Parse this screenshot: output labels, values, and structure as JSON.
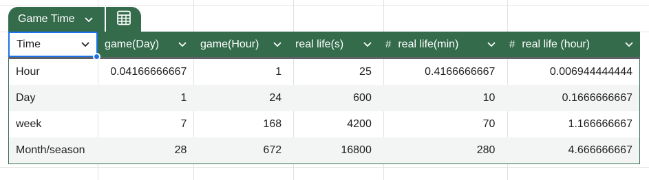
{
  "table_tab": {
    "name": "Game Time",
    "view_icon": "table-view-icon"
  },
  "columns": [
    {
      "label": "Time",
      "type_icon": "",
      "align": "left"
    },
    {
      "label": "game(Day)",
      "type_icon": "",
      "align": "right"
    },
    {
      "label": "game(Hour)",
      "type_icon": "",
      "align": "right"
    },
    {
      "label": "real life(s)",
      "type_icon": "",
      "align": "right"
    },
    {
      "label": "real life(min)",
      "type_icon": "#",
      "align": "right"
    },
    {
      "label": "real life (hour)",
      "type_icon": "#",
      "align": "right"
    }
  ],
  "rows": [
    [
      "Hour",
      "0.04166666667",
      "1",
      "25",
      "0.4166666667",
      "0.006944444444"
    ],
    [
      "Day",
      "1",
      "24",
      "600",
      "10",
      "0.1666666667"
    ],
    [
      "week",
      "7",
      "168",
      "4200",
      "70",
      "1.166666667"
    ],
    [
      "Month/season",
      "28",
      "672",
      "16800",
      "280",
      "4.666666667"
    ]
  ],
  "colors": {
    "header_bg": "#336b4b",
    "selection": "#1a73e8",
    "alt_row": "#f3f5f4"
  }
}
